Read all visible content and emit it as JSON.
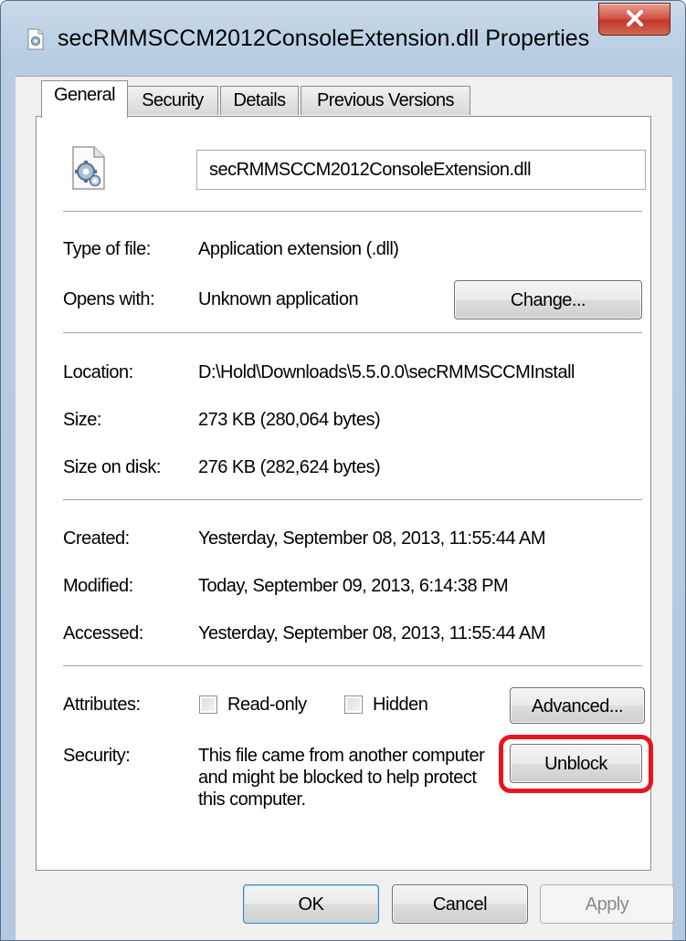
{
  "window": {
    "title": "secRMMSCCM2012ConsoleExtension.dll Properties",
    "close_label": "X"
  },
  "tabs": [
    {
      "label": "General",
      "active": true
    },
    {
      "label": "Security",
      "active": false
    },
    {
      "label": "Details",
      "active": false
    },
    {
      "label": "Previous Versions",
      "active": false
    }
  ],
  "general": {
    "file_name": "secRMMSCCM2012ConsoleExtension.dll",
    "type_label": "Type of file:",
    "type_value": "Application extension (.dll)",
    "opens_label": "Opens with:",
    "opens_value": "Unknown application",
    "change_button": "Change...",
    "location_label": "Location:",
    "location_value": "D:\\Hold\\Downloads\\5.5.0.0\\secRMMSCCMInstall",
    "size_label": "Size:",
    "size_value": "273 KB (280,064 bytes)",
    "size_disk_label": "Size on disk:",
    "size_disk_value": "276 KB (282,624 bytes)",
    "created_label": "Created:",
    "created_value": "Yesterday, September 08, 2013, 11:55:44 AM",
    "modified_label": "Modified:",
    "modified_value": "Today, September 09, 2013, 6:14:38 PM",
    "accessed_label": "Accessed:",
    "accessed_value": "Yesterday, September 08, 2013, 11:55:44 AM",
    "attributes_label": "Attributes:",
    "readonly_label": "Read-only",
    "readonly_checked": false,
    "hidden_label": "Hidden",
    "hidden_checked": false,
    "advanced_button": "Advanced...",
    "security_label": "Security:",
    "security_text": "This file came from another computer and might be blocked to help protect this computer.",
    "unblock_button": "Unblock"
  },
  "footer": {
    "ok": "OK",
    "cancel": "Cancel",
    "apply": "Apply"
  },
  "colors": {
    "highlight": "#e8161c",
    "close_button": "#c0392a"
  },
  "icons": {
    "title": "dll-gear-icon",
    "file": "dll-file-gear-icon",
    "close": "close-icon"
  }
}
